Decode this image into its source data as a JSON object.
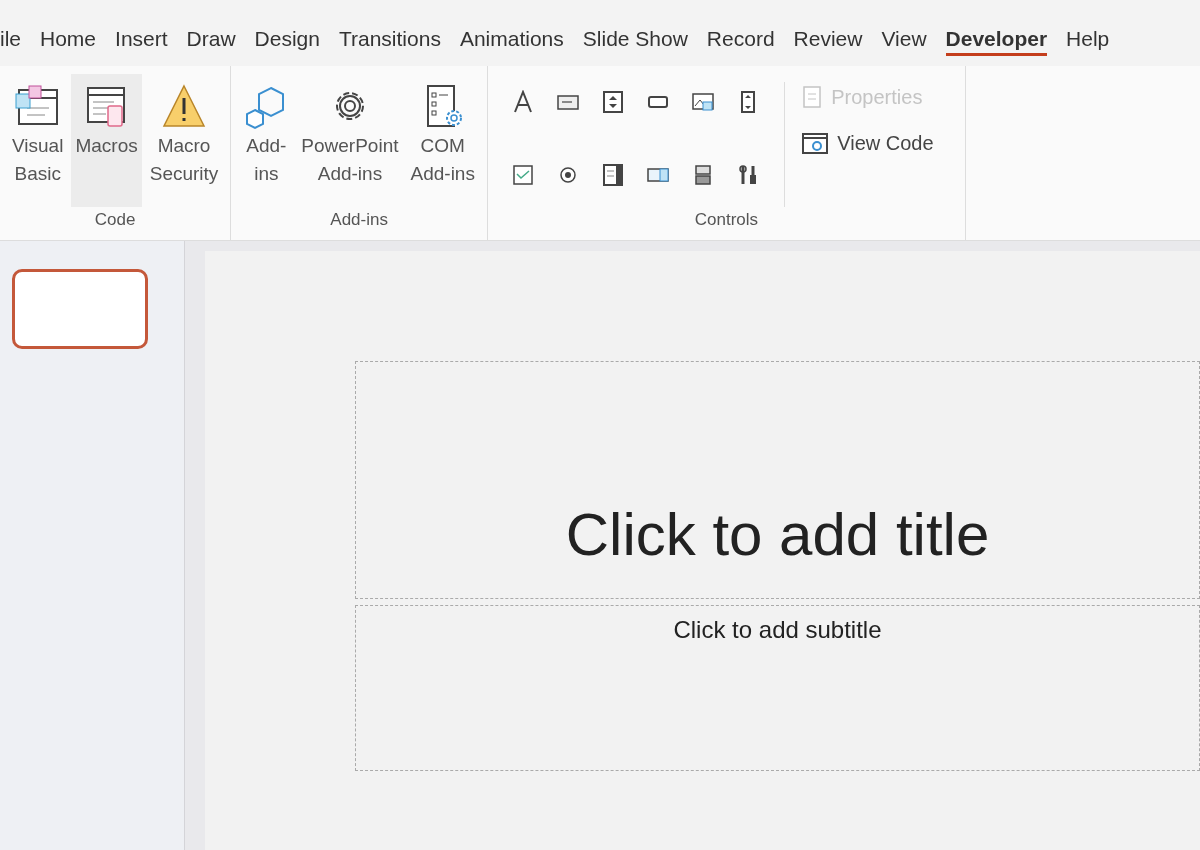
{
  "tabs": [
    {
      "label": "ile",
      "selected": false
    },
    {
      "label": "Home",
      "selected": false
    },
    {
      "label": "Insert",
      "selected": false
    },
    {
      "label": "Draw",
      "selected": false
    },
    {
      "label": "Design",
      "selected": false
    },
    {
      "label": "Transitions",
      "selected": false
    },
    {
      "label": "Animations",
      "selected": false
    },
    {
      "label": "Slide Show",
      "selected": false
    },
    {
      "label": "Record",
      "selected": false
    },
    {
      "label": "Review",
      "selected": false
    },
    {
      "label": "View",
      "selected": false
    },
    {
      "label": "Developer",
      "selected": true
    },
    {
      "label": "Help",
      "selected": false
    }
  ],
  "ribbon": {
    "groups": [
      {
        "label": "Code",
        "buttons": [
          {
            "kind": "visual-basic",
            "lines": [
              "Visual",
              "Basic"
            ],
            "hovered": false
          },
          {
            "kind": "macros",
            "lines": [
              "Macros"
            ],
            "hovered": true
          },
          {
            "kind": "security",
            "lines": [
              "Macro",
              "Security"
            ],
            "hovered": false
          }
        ]
      },
      {
        "label": "Add-ins",
        "buttons": [
          {
            "kind": "addins",
            "lines": [
              "Add-",
              "ins"
            ],
            "hovered": false
          },
          {
            "kind": "ppt-addins",
            "lines": [
              "PowerPoint",
              "Add-ins"
            ],
            "hovered": false
          },
          {
            "kind": "com-addins",
            "lines": [
              "COM",
              "Add-ins"
            ],
            "hovered": false
          }
        ]
      }
    ],
    "controls": {
      "label": "Controls",
      "side_buttons": [
        {
          "kind": "properties",
          "label": "Properties",
          "disabled": true
        },
        {
          "kind": "view-code",
          "label": "View Code",
          "disabled": false
        }
      ]
    }
  },
  "thumbnails": [
    {
      "selected": true
    }
  ],
  "slide": {
    "title_placeholder": "Click to add title",
    "subtitle_placeholder": "Click to add subtitle"
  }
}
